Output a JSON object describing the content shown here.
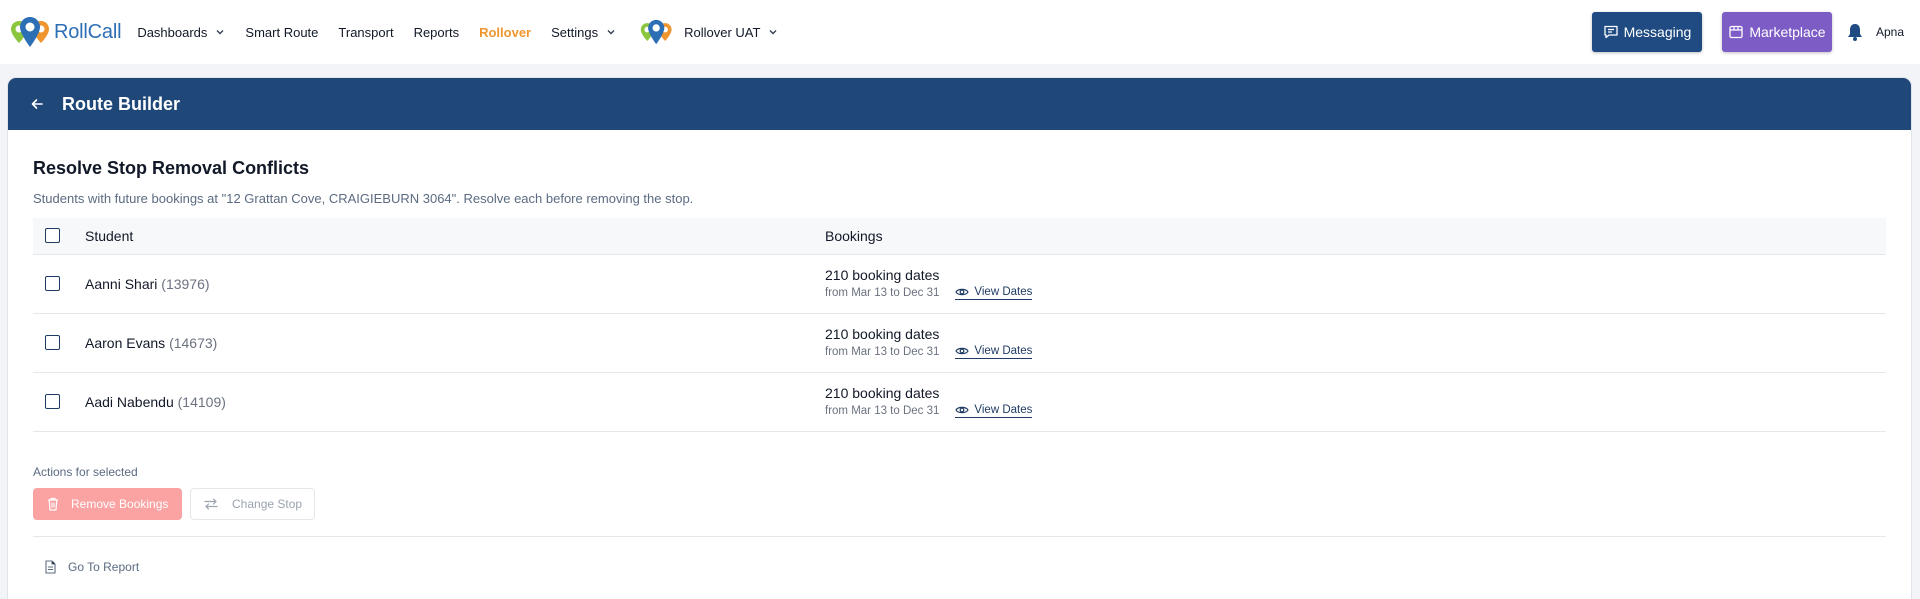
{
  "app": {
    "logo_text": "RollCall"
  },
  "nav": {
    "items": [
      {
        "label": "Dashboards",
        "has_menu": true
      },
      {
        "label": "Smart Route"
      },
      {
        "label": "Transport"
      },
      {
        "label": "Reports"
      },
      {
        "label": "Rollover",
        "active": true
      },
      {
        "label": "Settings",
        "has_menu": true
      }
    ],
    "org_name": "Rollover UAT",
    "messaging_label": "Messaging",
    "marketplace_label": "Marketplace",
    "user_name": "Apna"
  },
  "page": {
    "title": "Route Builder",
    "section_title": "Resolve Stop Removal Conflicts",
    "section_desc": "Students with future bookings at \"12 Grattan Cove, CRAIGIEBURN 3064\". Resolve each before removing the stop."
  },
  "table": {
    "headers": {
      "student": "Student",
      "bookings": "Bookings"
    },
    "rows": [
      {
        "name": "Aanni Shari",
        "id": "(13976)",
        "count": "210 booking dates",
        "range": "from Mar 13 to Dec 31",
        "view": "View Dates"
      },
      {
        "name": "Aaron Evans",
        "id": "(14673)",
        "count": "210 booking dates",
        "range": "from Mar 13 to Dec 31",
        "view": "View Dates"
      },
      {
        "name": "Aadi Nabendu",
        "id": "(14109)",
        "count": "210 booking dates",
        "range": "from Mar 13 to Dec 31",
        "view": "View Dates"
      }
    ]
  },
  "actions": {
    "label": "Actions for selected",
    "remove_label": "Remove Bookings",
    "change_label": "Change Stop",
    "report_label": "Go To Report"
  },
  "colors": {
    "header_bg": "#1f4879",
    "active_nav": "#f0962f",
    "messaging_bg": "#1f4b82",
    "marketplace_bg": "#7e5cc6",
    "remove_bg": "#fba3a3"
  }
}
